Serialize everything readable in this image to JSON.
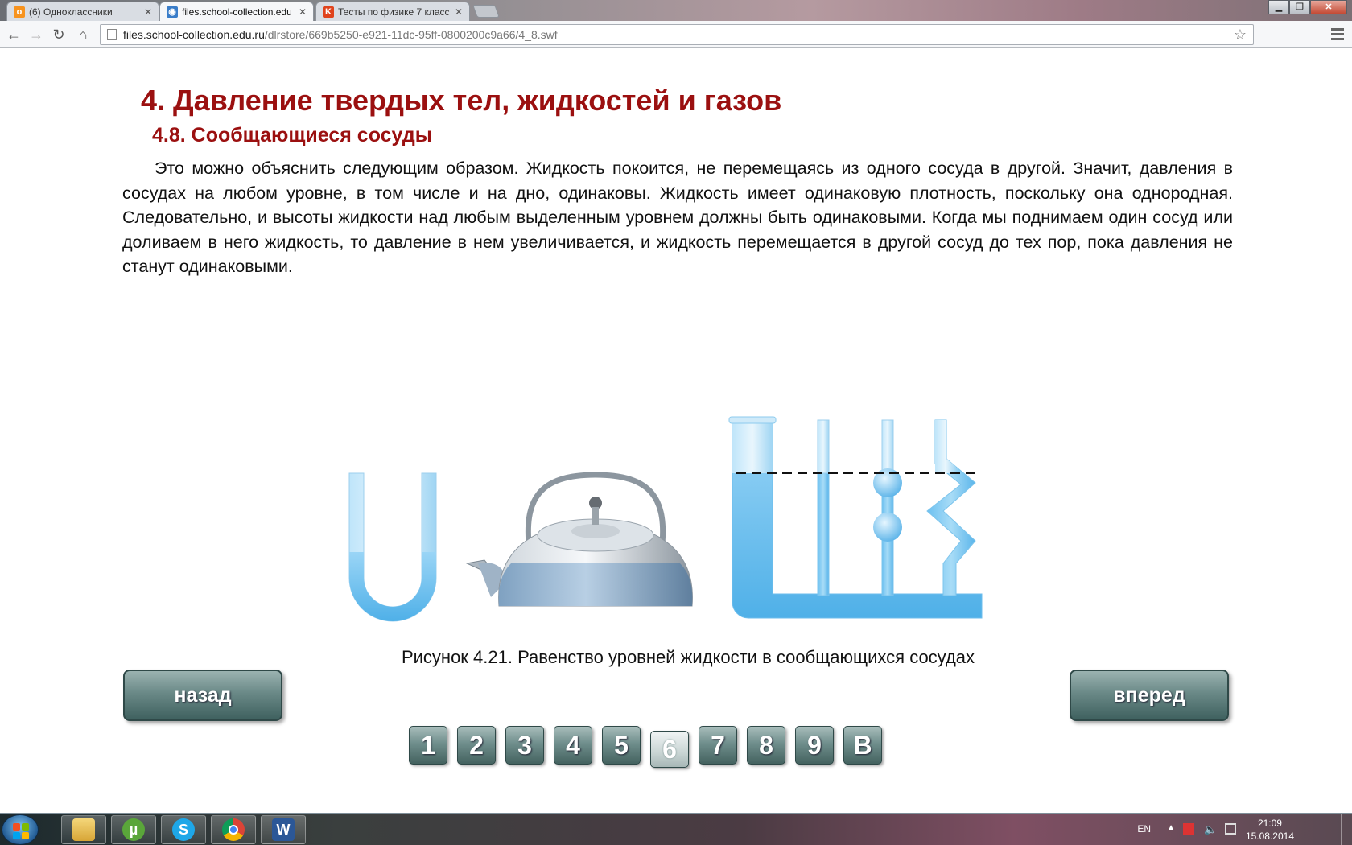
{
  "browser": {
    "tabs": [
      {
        "title": "(6) Одноклассники",
        "favicon": "ok-icon",
        "color": "#f7931e"
      },
      {
        "title": "files.school-collection.edu",
        "favicon": "globe-icon",
        "color": "#3a7dc9"
      },
      {
        "title": "Тесты по физике 7 класс",
        "favicon": "k-icon",
        "color": "#e0431c"
      }
    ],
    "url_host": "files.school-collection.edu.ru",
    "url_path": "/dlrstore/669b5250-e921-11dc-95ff-0800200c9a66/4_8.swf"
  },
  "page": {
    "title": "4. Давление твердых тел, жидкостей и газов",
    "subtitle": "4.8. Сообщающиеся сосуды",
    "paragraph": "Это можно объяснить следующим образом. Жидкость покоится, не перемещаясь из одного сосуда в другой. Значит, давления в сосудах на любом уровне, в том числе и на дно, одинаковы. Жидкость имеет одинаковую плотность, поскольку она однородная. Следовательно,  и высоты жидкости над любым выделенным уровнем должны быть одинаковыми. Когда мы поднимаем один сосуд или доливаем в него жидкость, то давление в нем увеличивается, и жидкость перемещается в другой сосуд до тех пор, пока давления не станут одинаковыми.",
    "caption": "Рисунок 4.21. Равенство уровней жидкости в сообщающихся сосудах",
    "back_label": "назад",
    "forward_label": "вперед",
    "pager": [
      "1",
      "2",
      "3",
      "4",
      "5",
      "6",
      "7",
      "8",
      "9",
      "В"
    ],
    "current_page": "6"
  },
  "taskbar": {
    "apps": [
      "file-explorer-icon",
      "utorrent-icon",
      "skype-icon",
      "chrome-icon",
      "word-icon"
    ],
    "lang": "EN",
    "time": "21:09",
    "date": "15.08.2014"
  },
  "colors": {
    "heading": "#9b1010",
    "water": "#8fd0f5",
    "button": "#5b7b79"
  }
}
